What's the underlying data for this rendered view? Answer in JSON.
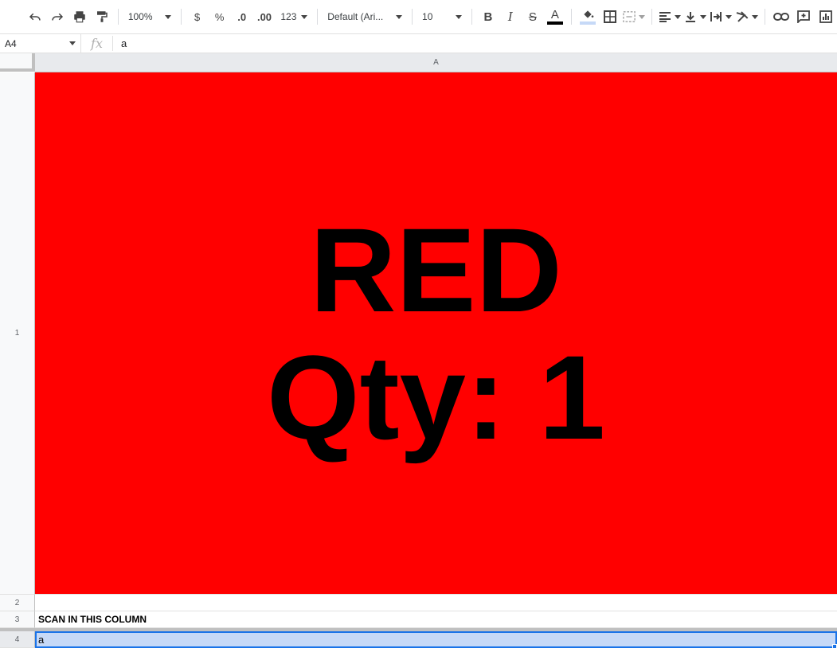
{
  "toolbar": {
    "zoom": "100%",
    "currency": "$",
    "percent": "%",
    "dec_decrease": ".0",
    "dec_increase": ".00",
    "more_formats": "123",
    "font": "Default (Ari...",
    "font_size": "10",
    "bold": "B",
    "italic": "I",
    "strike": "S",
    "text_color_letter": "A"
  },
  "formula_bar": {
    "cell_ref": "A4",
    "fx": "fx",
    "value": "a"
  },
  "grid": {
    "column_a": "A",
    "rows": [
      {
        "num": "1",
        "lines": [
          "RED",
          "Qty: 1"
        ],
        "bg": "#ff0000"
      },
      {
        "num": "2",
        "text": ""
      },
      {
        "num": "3",
        "text": "SCAN IN THIS COLUMN"
      },
      {
        "num": "4",
        "text": "a"
      }
    ]
  },
  "colors": {
    "selection_fill": "#c6d9f7",
    "selection_border": "#1a73e8"
  }
}
